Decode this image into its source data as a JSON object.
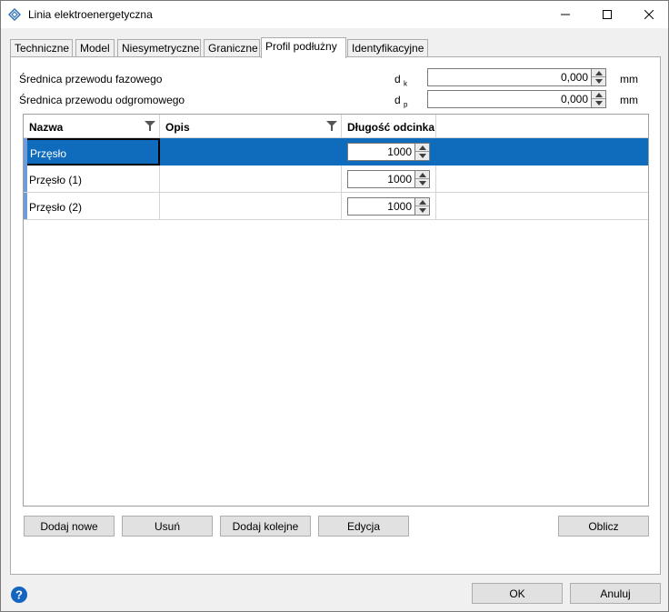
{
  "window": {
    "title": "Linia elektroenergetyczna"
  },
  "tabs": [
    {
      "label": "Techniczne"
    },
    {
      "label": "Model"
    },
    {
      "label": "Niesymetryczne"
    },
    {
      "label": "Graniczne"
    },
    {
      "label": "Profil podłużny"
    },
    {
      "label": "Identyfikacyjne"
    }
  ],
  "active_tab": "Profil podłużny",
  "fields": {
    "phase": {
      "label": "Średnica przewodu fazowego",
      "symbol": "d",
      "sub": "k",
      "value": "0,000",
      "unit": "mm"
    },
    "ground": {
      "label": "Średnica przewodu odgromowego",
      "symbol": "d",
      "sub": "p",
      "value": "0,000",
      "unit": "mm"
    }
  },
  "grid": {
    "columns": [
      {
        "label": "Nazwa"
      },
      {
        "label": "Opis"
      },
      {
        "label": "Długość odcinka"
      }
    ],
    "rows": [
      {
        "name": "Przęsło",
        "desc": "",
        "length": "1000",
        "selected": true
      },
      {
        "name": "Przęsło (1)",
        "desc": "",
        "length": "1000",
        "selected": false
      },
      {
        "name": "Przęsło (2)",
        "desc": "",
        "length": "1000",
        "selected": false
      }
    ]
  },
  "buttons": {
    "add_new": "Dodaj nowe",
    "remove": "Usuń",
    "add_next": "Dodaj kolejne",
    "edit": "Edycja",
    "compute": "Oblicz",
    "ok": "OK",
    "cancel": "Anuluj"
  },
  "colors": {
    "selection": "#0f6cbd",
    "row_marker": "#6f9bd8",
    "help_icon": "#1565c0"
  }
}
